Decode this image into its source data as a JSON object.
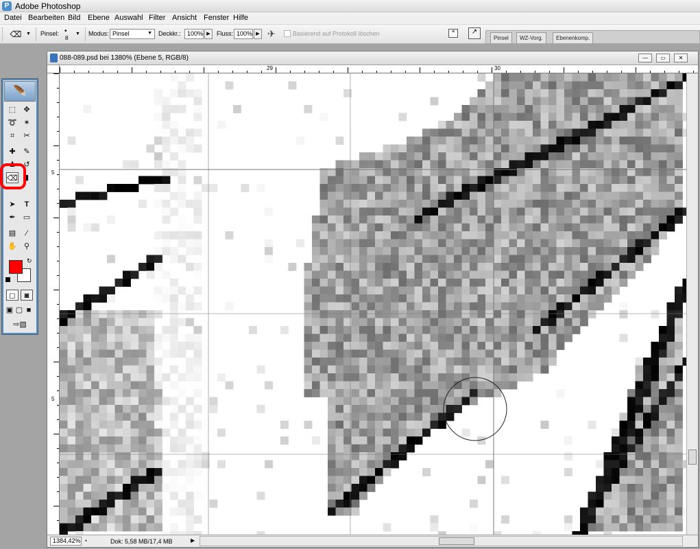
{
  "app": {
    "title": "Adobe Photoshop"
  },
  "menu": [
    "Datei",
    "Bearbeiten",
    "Bild",
    "Ebene",
    "Auswahl",
    "Filter",
    "Ansicht",
    "Fenster",
    "Hilfe"
  ],
  "options": {
    "brush_label": "Pinsel:",
    "brush_size": "8",
    "mode_label": "Modus:",
    "mode_value": "Pinsel",
    "opacity_label": "Deckkr.:",
    "opacity_value": "100%",
    "flow_label": "Fluss:",
    "flow_value": "100%",
    "erase_history_label": "Basierend auf Protokoll löschen",
    "erase_history_checked": false
  },
  "palette_well": [
    "Pinsel",
    "WZ-Vorg.",
    "Ebenenkomp."
  ],
  "document": {
    "title": "088-089.psd bei 1380% (Ebene 5, RGB/8)",
    "ruler_top": [
      "29",
      "30"
    ],
    "ruler_left": [
      "5",
      "5"
    ],
    "zoom": "1384,42%",
    "doc_info": "Dok: 5,58 MB/17,4 MB"
  },
  "colors": {
    "foreground": "#ff0000",
    "background": "#ffffff",
    "highlight": "#ff0000"
  },
  "tools": [
    "rectangular-marquee",
    "move",
    "lasso",
    "magic-wand",
    "crop",
    "slice",
    "healing-brush",
    "brush",
    "clone-stamp",
    "history-brush",
    "eraser",
    "gradient",
    "path-selection",
    "type",
    "pen",
    "shape",
    "notes",
    "eyedropper",
    "hand",
    "zoom"
  ]
}
